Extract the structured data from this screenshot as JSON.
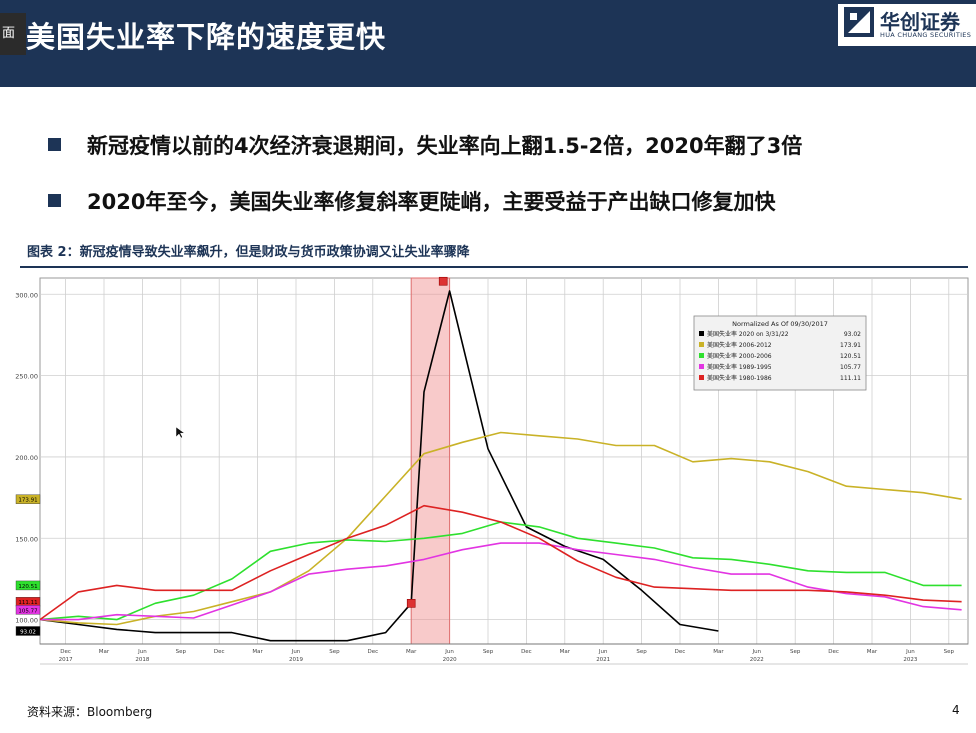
{
  "header": {
    "tab_label": "面",
    "title": "美国失业率下降的速度更快",
    "logo_cn": "华创证券",
    "logo_en": "HUA CHUANG SECURITIES"
  },
  "bullets": [
    "新冠疫情以前的4次经济衰退期间，失业率向上翻1.5-2倍，2020年翻了3倍",
    "2020年至今，美国失业率修复斜率更陡峭，主要受益于产出缺口修复加快"
  ],
  "figure_title": "图表 2：新冠疫情导致失业率飙升，但是财政与货币政策协调又让失业率骤降",
  "source": "资料来源：Bloomberg",
  "page_number": "4",
  "chart_data": {
    "type": "line",
    "legend_title": "Normalized As Of 09/30/2017",
    "legend_position": "top-right",
    "ylim": [
      85,
      310
    ],
    "y_ticks": [
      100,
      150,
      200,
      250,
      300
    ],
    "y_tick_labels": [
      "100.00",
      "150.00",
      "200.00",
      "250.00",
      "300.00"
    ],
    "x_ticks": [
      {
        "x": 2,
        "label": "Dec",
        "year": "2017"
      },
      {
        "x": 5,
        "label": "Mar",
        "year": ""
      },
      {
        "x": 8,
        "label": "Jun",
        "year": "2018"
      },
      {
        "x": 11,
        "label": "Sep",
        "year": ""
      },
      {
        "x": 14,
        "label": "Dec",
        "year": ""
      },
      {
        "x": 17,
        "label": "Mar",
        "year": ""
      },
      {
        "x": 20,
        "label": "Jun",
        "year": "2019"
      },
      {
        "x": 23,
        "label": "Sep",
        "year": ""
      },
      {
        "x": 26,
        "label": "Dec",
        "year": ""
      },
      {
        "x": 29,
        "label": "Mar",
        "year": ""
      },
      {
        "x": 32,
        "label": "Jun",
        "year": "2020"
      },
      {
        "x": 35,
        "label": "Sep",
        "year": ""
      },
      {
        "x": 38,
        "label": "Dec",
        "year": ""
      },
      {
        "x": 41,
        "label": "Mar",
        "year": ""
      },
      {
        "x": 44,
        "label": "Jun",
        "year": "2021"
      },
      {
        "x": 47,
        "label": "Sep",
        "year": ""
      },
      {
        "x": 50,
        "label": "Dec",
        "year": ""
      },
      {
        "x": 53,
        "label": "Mar",
        "year": ""
      },
      {
        "x": 56,
        "label": "Jun",
        "year": "2022"
      },
      {
        "x": 59,
        "label": "Sep",
        "year": ""
      },
      {
        "x": 62,
        "label": "Dec",
        "year": ""
      },
      {
        "x": 65,
        "label": "Mar",
        "year": ""
      },
      {
        "x": 68,
        "label": "Jun",
        "year": "2023"
      },
      {
        "x": 71,
        "label": "Sep",
        "year": ""
      }
    ],
    "highlight_band": [
      29,
      32
    ],
    "series": [
      {
        "name": "美国失业率 2020 on 3/31/22",
        "value_label": "93.02",
        "color": "#000000",
        "x": [
          0,
          3,
          6,
          9,
          12,
          15,
          18,
          21,
          24,
          27,
          29,
          30,
          32,
          35,
          38,
          41,
          44,
          47,
          50,
          53
        ],
        "values": [
          100,
          97,
          94,
          92,
          92,
          92,
          87,
          87,
          87,
          92,
          110,
          240,
          302,
          205,
          157,
          145,
          137,
          118,
          97,
          93
        ]
      },
      {
        "name": "美国失业率 2006-2012",
        "value_label": "173.91",
        "color": "#c9b227",
        "x": [
          0,
          3,
          6,
          9,
          12,
          15,
          18,
          21,
          24,
          27,
          30,
          33,
          36,
          39,
          42,
          45,
          48,
          51,
          54,
          57,
          60,
          63,
          66,
          69,
          72
        ],
        "values": [
          100,
          98,
          97,
          102,
          105,
          111,
          117,
          130,
          150,
          176,
          202,
          209,
          215,
          213,
          211,
          207,
          207,
          197,
          199,
          197,
          191,
          182,
          180,
          178,
          174
        ]
      },
      {
        "name": "美国失业率 2000-2006",
        "value_label": "120.51",
        "color": "#2ee02e",
        "x": [
          0,
          3,
          6,
          9,
          12,
          15,
          18,
          21,
          24,
          27,
          30,
          33,
          36,
          39,
          42,
          45,
          48,
          51,
          54,
          57,
          60,
          63,
          66,
          69,
          72
        ],
        "values": [
          100,
          102,
          100,
          110,
          115,
          125,
          142,
          147,
          149,
          148,
          150,
          153,
          160,
          157,
          150,
          147,
          144,
          138,
          137,
          134,
          130,
          129,
          129,
          121,
          121
        ]
      },
      {
        "name": "美国失业率 1989-1995",
        "value_label": "105.77",
        "color": "#e234e2",
        "x": [
          0,
          3,
          6,
          9,
          12,
          15,
          18,
          21,
          24,
          27,
          30,
          33,
          36,
          39,
          42,
          45,
          48,
          51,
          54,
          57,
          60,
          63,
          66,
          69,
          72
        ],
        "values": [
          100,
          100,
          103,
          102,
          101,
          109,
          117,
          128,
          131,
          133,
          137,
          143,
          147,
          147,
          143,
          140,
          137,
          132,
          128,
          128,
          120,
          116,
          114,
          108,
          106
        ]
      },
      {
        "name": "美国失业率 1980-1986",
        "value_label": "111.11",
        "color": "#dd2222",
        "x": [
          0,
          3,
          6,
          9,
          12,
          15,
          18,
          21,
          24,
          27,
          30,
          33,
          36,
          39,
          42,
          45,
          48,
          51,
          54,
          57,
          60,
          63,
          66,
          69,
          72
        ],
        "values": [
          100,
          117,
          121,
          118,
          118,
          118,
          130,
          140,
          150,
          158,
          170,
          166,
          160,
          150,
          136,
          126,
          120,
          119,
          118,
          118,
          118,
          117,
          115,
          112,
          111
        ]
      }
    ]
  }
}
